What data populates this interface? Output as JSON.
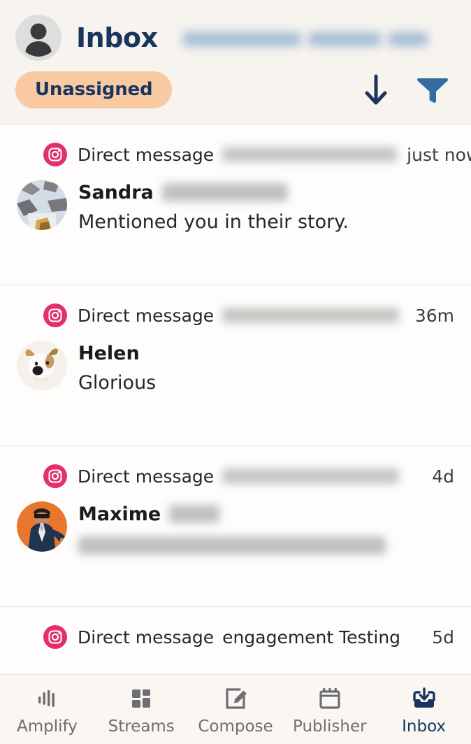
{
  "header": {
    "title": "Inbox",
    "avatar_icon": "user-avatar-icon",
    "brand_redacted": true,
    "filter_pill": "Unassigned",
    "sort_icon": "arrow-down-icon",
    "filter_icon": "funnel-filter-icon"
  },
  "colors": {
    "page_bg": "#FAF7F4",
    "header_bg": "#F7F3EF",
    "list_bg": "#FFFDFB",
    "navy": "#17355E",
    "pill_bg": "#F9C9A2",
    "instagram_pink": "#E1306C",
    "filter_blue": "#336C9E",
    "nav_inactive": "#6E6E72",
    "divider": "#E8E4E0"
  },
  "messages": [
    {
      "channel_icon": "instagram-icon",
      "kind": "Direct message",
      "account": "",
      "account_redacted": true,
      "account_blur_width": 250,
      "time": "just now",
      "sender": "Sandra",
      "sender_last_redacted": true,
      "sender_blur_width": 180,
      "preview": "Mentioned you in their story.",
      "preview_redacted": false,
      "avatar_icon": "sandra-photo-avatar"
    },
    {
      "channel_icon": "instagram-icon",
      "kind": "Direct message",
      "account": "",
      "account_redacted": true,
      "account_blur_width": 253,
      "time": "36m",
      "sender": "Helen",
      "sender_last_redacted": false,
      "sender_blur_width": 0,
      "preview": "Glorious",
      "preview_redacted": false,
      "avatar_icon": "helen-dog-avatar"
    },
    {
      "channel_icon": "instagram-icon",
      "kind": "Direct message",
      "account": "",
      "account_redacted": true,
      "account_blur_width": 253,
      "time": "4d",
      "sender": "Maxime",
      "sender_last_redacted": true,
      "sender_blur_width": 72,
      "preview": "",
      "preview_redacted": true,
      "avatar_icon": "maxime-photo-avatar"
    },
    {
      "channel_icon": "instagram-icon",
      "kind": "Direct message",
      "account": "engagement Testing",
      "account_redacted": false,
      "account_blur_width": 0,
      "time": "5d",
      "sender": "",
      "sender_last_redacted": false,
      "sender_blur_width": 0,
      "preview": "",
      "preview_redacted": false,
      "avatar_icon": ""
    }
  ],
  "bottom_nav": {
    "items": [
      {
        "label": "Amplify",
        "icon": "amplify-bars-icon",
        "active": false
      },
      {
        "label": "Streams",
        "icon": "streams-grid-icon",
        "active": false
      },
      {
        "label": "Compose",
        "icon": "compose-pencil-icon",
        "active": false
      },
      {
        "label": "Publisher",
        "icon": "calendar-icon",
        "active": false
      },
      {
        "label": "Inbox",
        "icon": "inbox-tray-icon",
        "active": true
      }
    ]
  }
}
